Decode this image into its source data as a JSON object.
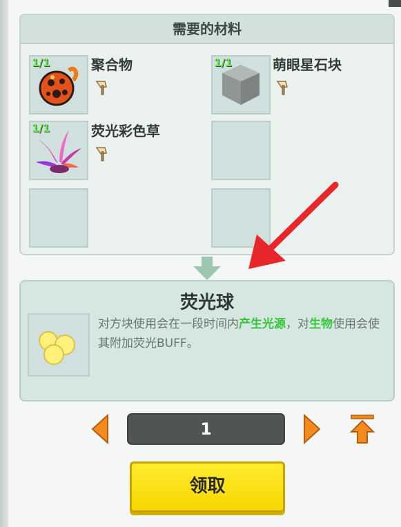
{
  "materials_panel": {
    "title": "需要的材料",
    "items": [
      {
        "name": "聚合物",
        "count": "1/1",
        "icon": "polymer-icon"
      },
      {
        "name": "萌眼星石块",
        "count": "1/1",
        "icon": "stone-block-icon"
      },
      {
        "name": "荧光彩色草",
        "count": "1/1",
        "icon": "fluorescent-grass-icon"
      }
    ]
  },
  "result": {
    "title": "荧光球",
    "icon": "fluorescent-ball-icon",
    "desc_part1": "对方块使用会在一段时间内",
    "desc_highlight1": "产生光源",
    "desc_part2": "，对",
    "desc_highlight2": "生物",
    "desc_part3": "使用会使其附加荧光BUFF。"
  },
  "quantity": {
    "value": "1"
  },
  "claim_button": {
    "label": "领取"
  },
  "colors": {
    "highlight": "#36c63a",
    "button": "#ffe11a",
    "annotation": "#e8272d"
  }
}
